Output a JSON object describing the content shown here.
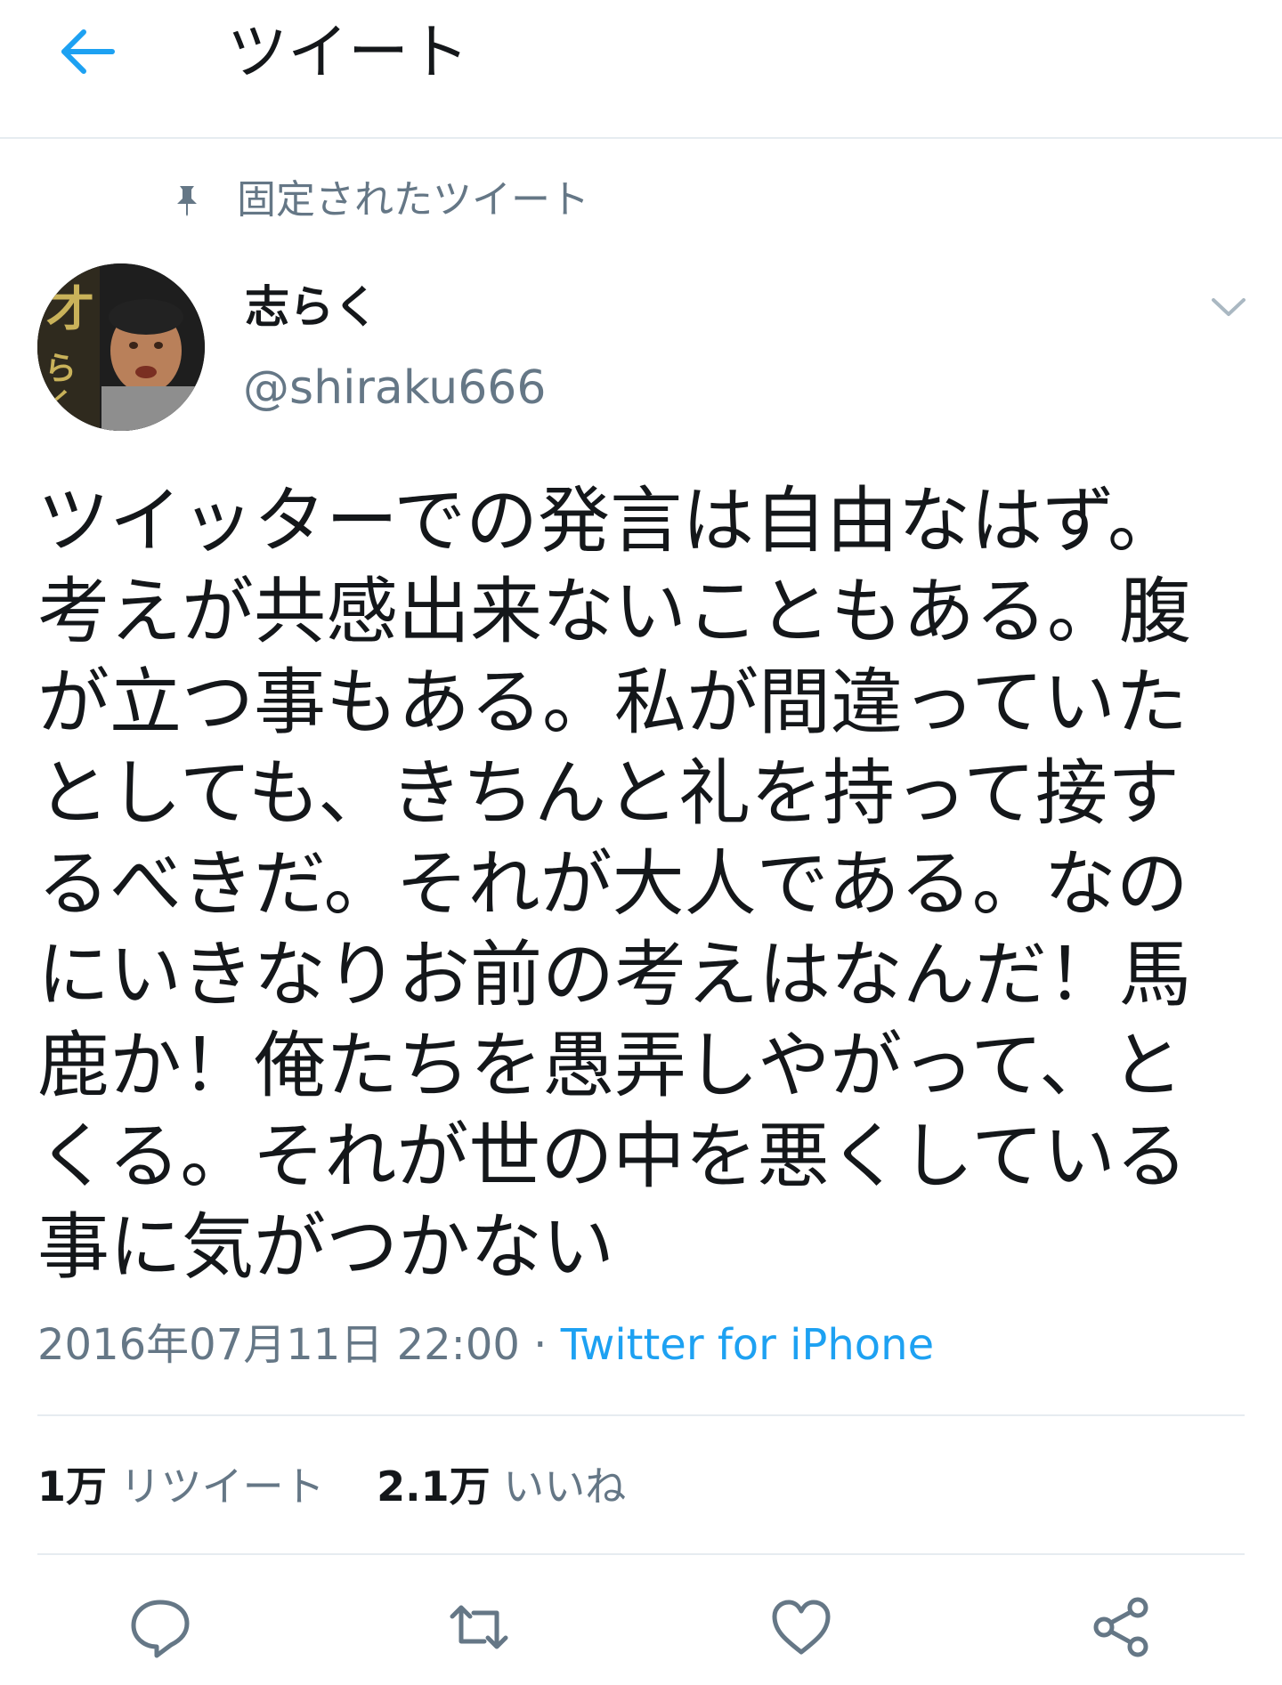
{
  "header": {
    "title": "ツイート",
    "back_icon": "arrow-left-icon",
    "accent_color": "#1da1f2"
  },
  "pinned": {
    "icon": "pin-icon",
    "label": "固定されたツイート"
  },
  "user": {
    "display_name": "志らく",
    "handle": "@shiraku666"
  },
  "tweet": {
    "text": "ツイッターでの発言は自由なはず。考えが共感出来ないこともある。腹が立つ事もある。私が間違っていたとしても、きちんと礼を持って接するべきだ。それが大人である。なのにいきなりお前の考えはなんだ！馬鹿か！俺たちを愚弄しやがって、とくる。それが世の中を悪くしている事に気がつかない",
    "timestamp": "2016年07月11日 22:00",
    "separator": " · ",
    "source": "Twitter for iPhone"
  },
  "stats": {
    "retweets_count": "1万",
    "retweets_label": "リツイート",
    "likes_count": "2.1万",
    "likes_label": "いいね"
  },
  "actions": [
    "reply-icon",
    "retweet-icon",
    "like-icon",
    "share-icon"
  ]
}
